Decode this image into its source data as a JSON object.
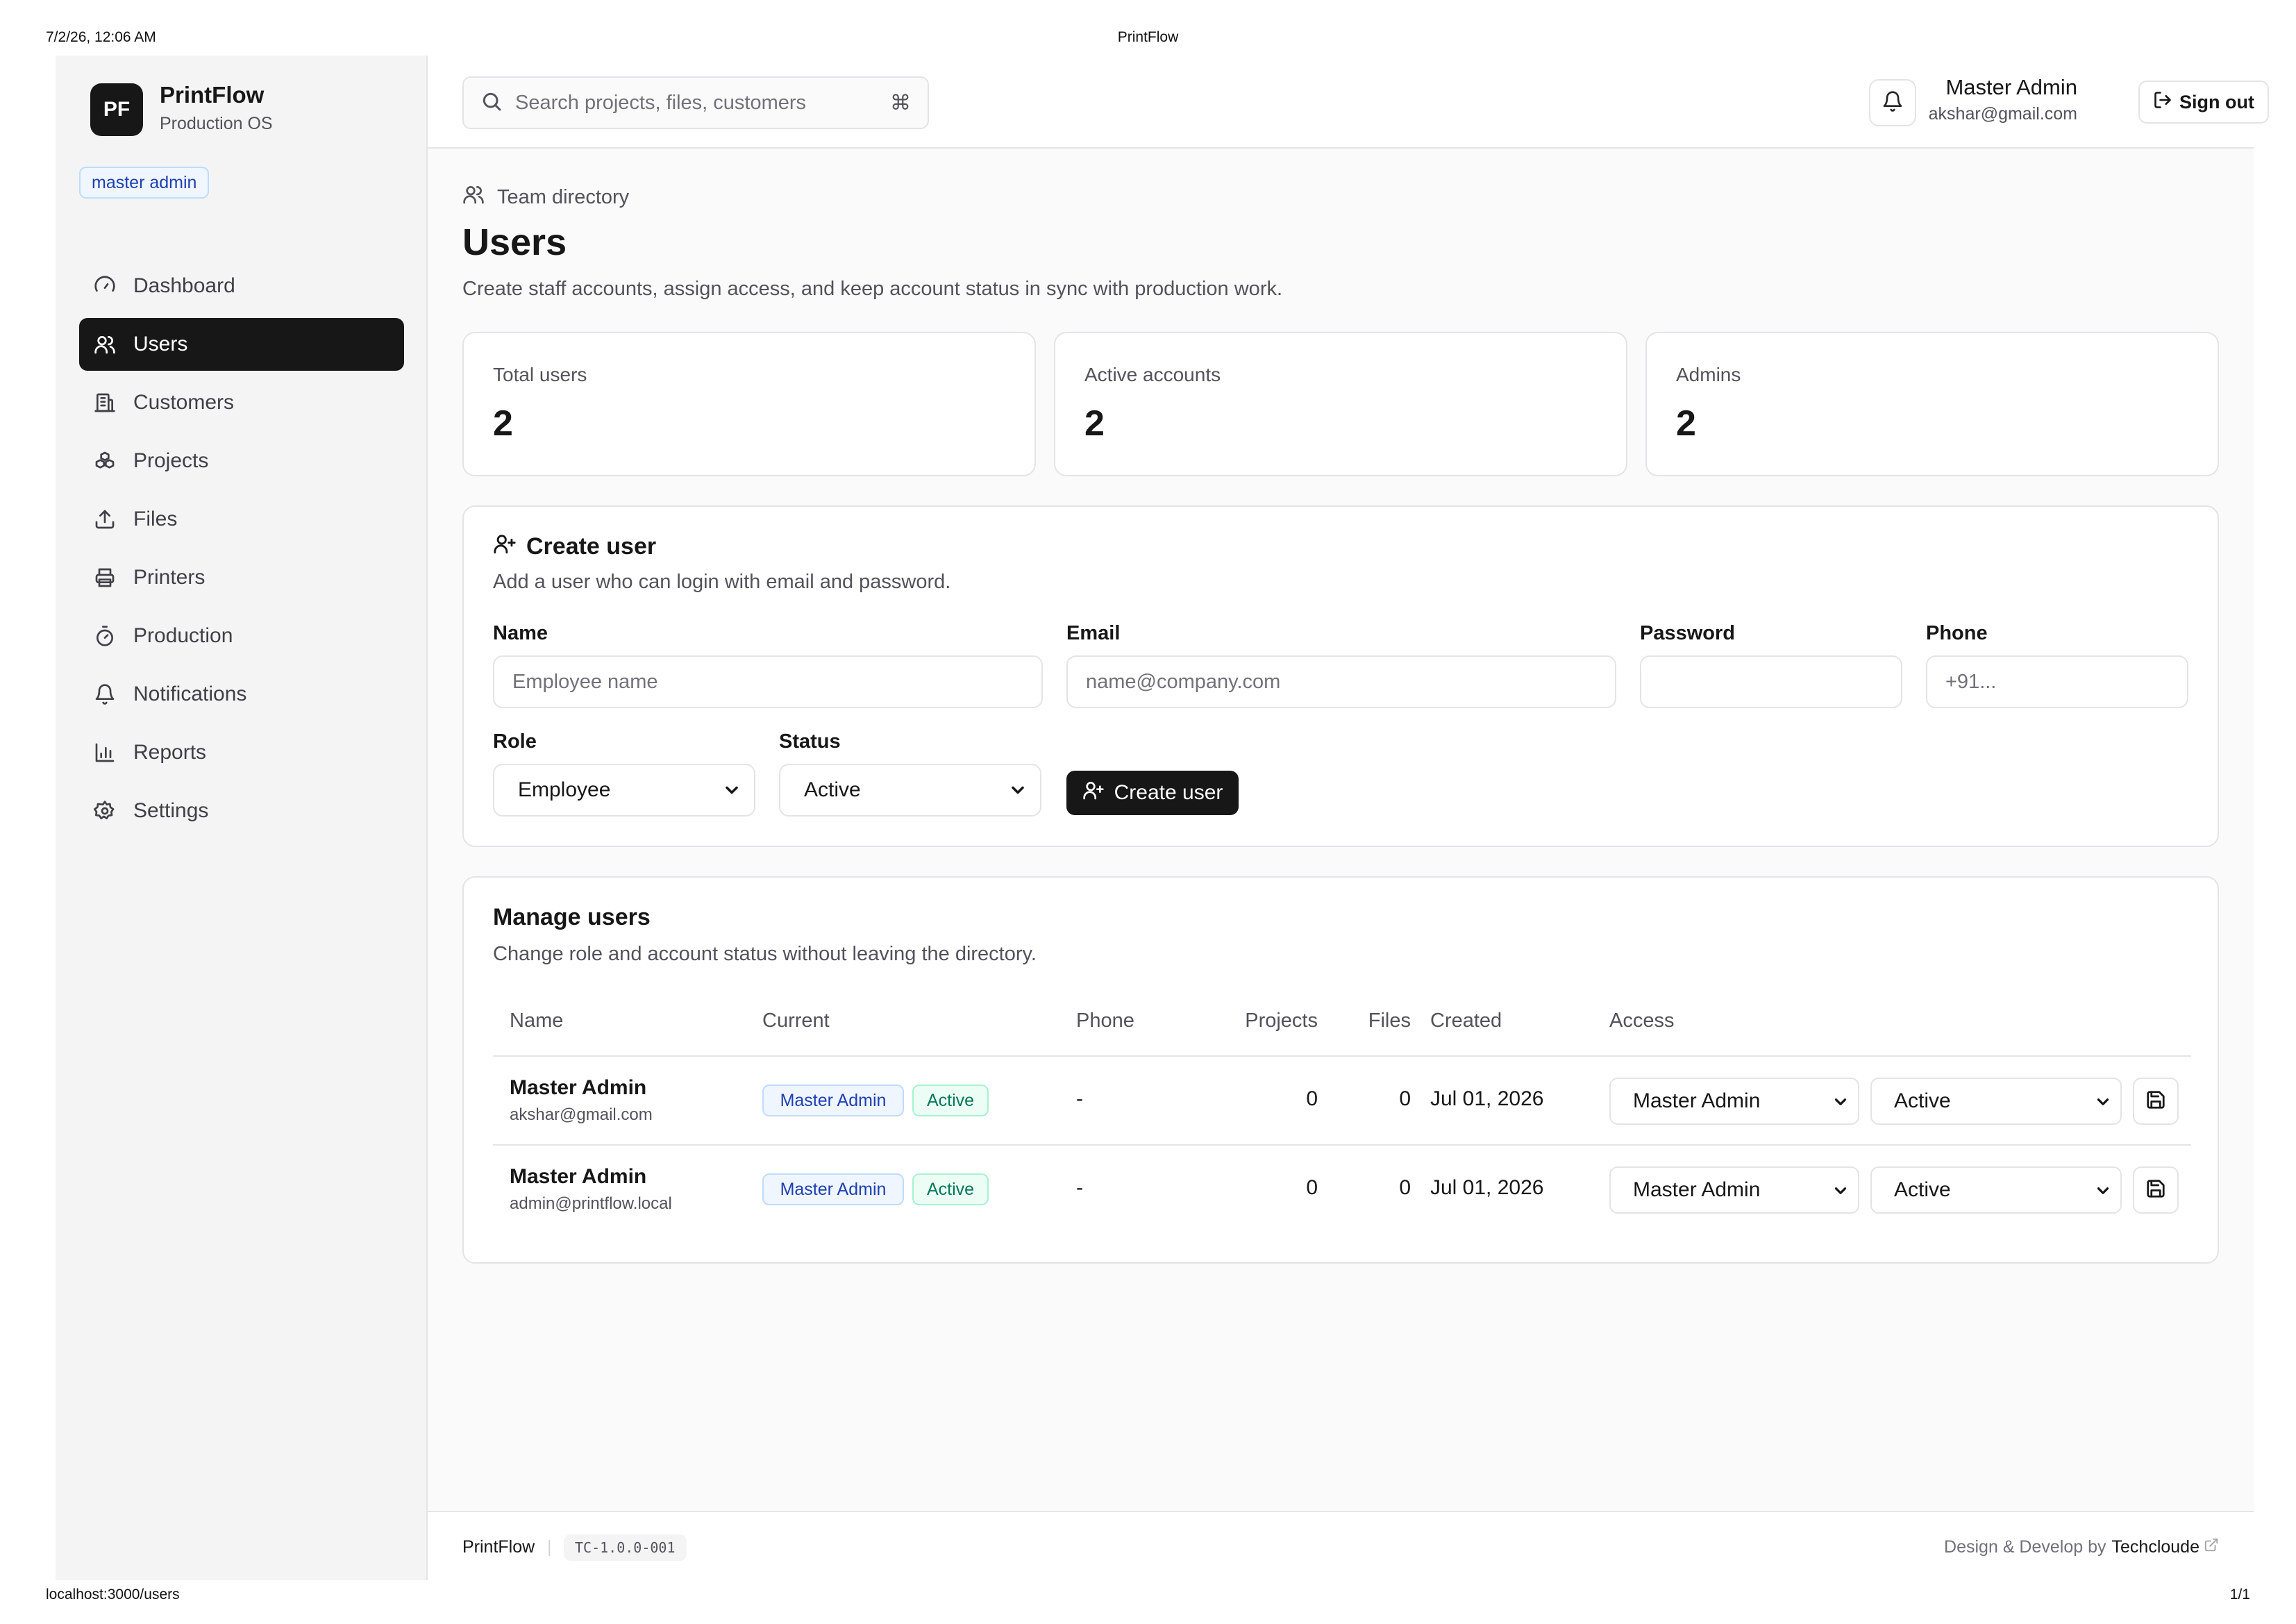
{
  "print": {
    "datetime": "7/2/26, 12:06 AM",
    "title": "PrintFlow",
    "url": "localhost:3000/users",
    "page": "1/1"
  },
  "brand": {
    "logo": "PF",
    "name": "PrintFlow",
    "subtitle": "Production OS",
    "role_badge": "master admin"
  },
  "sidebar": {
    "items": [
      {
        "label": "Dashboard",
        "icon": "gauge-icon"
      },
      {
        "label": "Users",
        "icon": "users-icon",
        "active": true
      },
      {
        "label": "Customers",
        "icon": "building-icon"
      },
      {
        "label": "Projects",
        "icon": "boxes-icon"
      },
      {
        "label": "Files",
        "icon": "upload-icon"
      },
      {
        "label": "Printers",
        "icon": "printer-icon"
      },
      {
        "label": "Production",
        "icon": "timer-icon"
      },
      {
        "label": "Notifications",
        "icon": "bell-icon"
      },
      {
        "label": "Reports",
        "icon": "bar-chart-icon"
      },
      {
        "label": "Settings",
        "icon": "gear-icon"
      }
    ]
  },
  "topbar": {
    "search_placeholder": "Search projects, files, customers",
    "search_shortcut": "⌘",
    "user_name": "Master Admin",
    "user_email": "akshar@gmail.com",
    "signout_label": "Sign out"
  },
  "page": {
    "eyebrow": "Team directory",
    "title": "Users",
    "description": "Create staff accounts, assign access, and keep account status in sync with production work."
  },
  "stats": [
    {
      "label": "Total users",
      "value": "2"
    },
    {
      "label": "Active accounts",
      "value": "2"
    },
    {
      "label": "Admins",
      "value": "2"
    }
  ],
  "create_user": {
    "title": "Create user",
    "description": "Add a user who can login with email and password.",
    "name_label": "Name",
    "name_placeholder": "Employee name",
    "email_label": "Email",
    "email_placeholder": "name@company.com",
    "password_label": "Password",
    "password_placeholder": "",
    "phone_label": "Phone",
    "phone_placeholder": "+91...",
    "role_label": "Role",
    "role_value": "Employee",
    "status_label": "Status",
    "status_value": "Active",
    "submit_label": "Create user"
  },
  "manage_users": {
    "title": "Manage users",
    "description": "Change role and account status without leaving the directory.",
    "columns": [
      "Name",
      "Current",
      "Phone",
      "Projects",
      "Files",
      "Created",
      "Access"
    ],
    "rows": [
      {
        "name": "Master Admin",
        "email": "akshar@gmail.com",
        "role_badge": "Master Admin",
        "status_badge": "Active",
        "phone": "-",
        "projects": "0",
        "files": "0",
        "created": "Jul 01, 2026",
        "access_role": "Master Admin",
        "access_status": "Active"
      },
      {
        "name": "Master Admin",
        "email": "admin@printflow.local",
        "role_badge": "Master Admin",
        "status_badge": "Active",
        "phone": "-",
        "projects": "0",
        "files": "0",
        "created": "Jul 01, 2026",
        "access_role": "Master Admin",
        "access_status": "Active"
      }
    ]
  },
  "footer": {
    "brand": "PrintFlow",
    "separator": "|",
    "version": "TC-1.0.0-001",
    "credit_prefix": "Design & Develop by",
    "credit_link": "Techcloude"
  },
  "colors": {
    "primary": "#171717",
    "badge_blue": "#1e40af",
    "badge_green": "#047857",
    "sidebar_bg": "#f4f4f5"
  }
}
